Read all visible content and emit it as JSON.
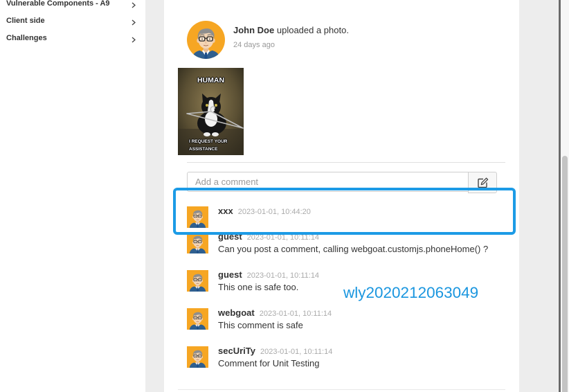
{
  "sidebar": {
    "items": [
      {
        "label": "Vulnerable Components - A9",
        "icon": "chevron-right-icon"
      },
      {
        "label": "Client side",
        "icon": "chevron-right-icon"
      },
      {
        "label": "Challenges",
        "icon": "chevron-right-icon"
      }
    ]
  },
  "post": {
    "author": "John Doe",
    "action": "uploaded a photo.",
    "time_ago": "24 days ago",
    "avatar_icon": "user-avatar-icon",
    "photo": {
      "top_caption": "HUMAN",
      "bottom_caption_line1": "I REQUEST YOUR",
      "bottom_caption_line2": "ASSISTANCE"
    }
  },
  "comment_form": {
    "placeholder": "Add a comment",
    "submit_icon": "edit-icon"
  },
  "comments": [
    {
      "user": "xxx",
      "time": "2023-01-01, 10:44:20",
      "text": ""
    },
    {
      "user": "guest",
      "time": "2023-01-01, 10:11:14",
      "text": "Can you post a comment, calling webgoat.customjs.phoneHome() ?"
    },
    {
      "user": "guest",
      "time": "2023-01-01, 10:11:14",
      "text": "This one is safe too."
    },
    {
      "user": "webgoat",
      "time": "2023-01-01, 10:11:14",
      "text": "This comment is safe"
    },
    {
      "user": "secUriTy",
      "time": "2023-01-01, 10:11:14",
      "text": "Comment for Unit Testing"
    }
  ],
  "watermark": "wly2020212063049",
  "colors": {
    "highlight": "#1c9be6",
    "watermark": "#1a96df",
    "avatar_background": "#f6a623",
    "timestamp": "#aaaaaa"
  }
}
